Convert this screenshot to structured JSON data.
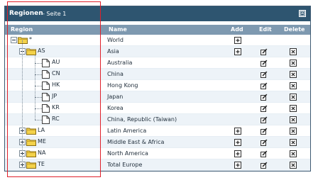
{
  "panel": {
    "title": "Regionen",
    "subtitle": "- Seite 1",
    "collapse_icon": "collapse-icon"
  },
  "columns": {
    "region": "Region",
    "name": "Name",
    "add": "Add",
    "edit": "Edit",
    "delete": "Delete"
  },
  "rows": [
    {
      "code": "*",
      "name": "World",
      "level": 0,
      "type": "folder",
      "add": true,
      "edit": false,
      "delete": false
    },
    {
      "code": "AS",
      "name": "Asia",
      "level": 1,
      "type": "folder",
      "add": true,
      "edit": true,
      "delete": true
    },
    {
      "code": "AU",
      "name": "Australia",
      "level": 2,
      "type": "file",
      "add": false,
      "edit": true,
      "delete": true
    },
    {
      "code": "CN",
      "name": "China",
      "level": 2,
      "type": "file",
      "add": false,
      "edit": true,
      "delete": true
    },
    {
      "code": "HK",
      "name": "Hong Kong",
      "level": 2,
      "type": "file",
      "add": false,
      "edit": true,
      "delete": true
    },
    {
      "code": "JP",
      "name": "Japan",
      "level": 2,
      "type": "file",
      "add": false,
      "edit": true,
      "delete": true
    },
    {
      "code": "KR",
      "name": "Korea",
      "level": 2,
      "type": "file",
      "add": false,
      "edit": true,
      "delete": true
    },
    {
      "code": "RC",
      "name": "China, Republic (Taiwan)",
      "level": 2,
      "type": "file",
      "add": false,
      "edit": true,
      "delete": true
    },
    {
      "code": "LA",
      "name": "Latin America",
      "level": 1,
      "type": "folder",
      "add": true,
      "edit": true,
      "delete": true
    },
    {
      "code": "ME",
      "name": "Middle East & Africa",
      "level": 1,
      "type": "folder",
      "add": true,
      "edit": true,
      "delete": true
    },
    {
      "code": "NA",
      "name": "North America",
      "level": 1,
      "type": "folder",
      "add": true,
      "edit": true,
      "delete": true
    },
    {
      "code": "TE",
      "name": "Total Europe",
      "level": 1,
      "type": "folder",
      "add": true,
      "edit": true,
      "delete": true
    }
  ],
  "colors": {
    "titlebar": "#2e5570",
    "header": "#7e99b0",
    "highlight_box": "#e0202a"
  }
}
